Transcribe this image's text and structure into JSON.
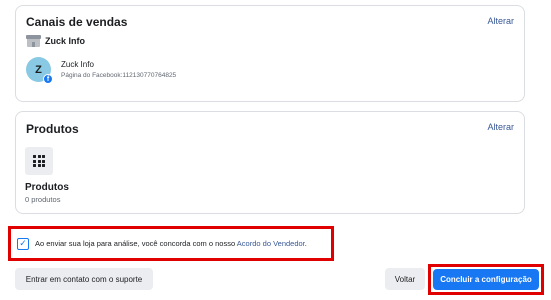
{
  "sales_channels": {
    "title": "Canais de vendas",
    "change_label": "Alterar",
    "shop_name": "Zuck Info",
    "page": {
      "avatar_initial": "Z",
      "name": "Zuck Info",
      "id_text": "Página do Facebook:112130770764825"
    }
  },
  "products": {
    "title": "Produtos",
    "change_label": "Alterar",
    "label": "Produtos",
    "count_text": "0 produtos"
  },
  "agreement": {
    "text": "Ao enviar sua loja para análise, você concorda com o nosso ",
    "link": "Acordo do Vendedor",
    "suffix": ".",
    "checked": true
  },
  "footer": {
    "support_label": "Entrar em contato com o suporte",
    "back_label": "Voltar",
    "finish_label": "Concluir a configuração"
  },
  "colors": {
    "accent": "#1877f2",
    "link": "#385898",
    "highlight": "#e00000"
  }
}
